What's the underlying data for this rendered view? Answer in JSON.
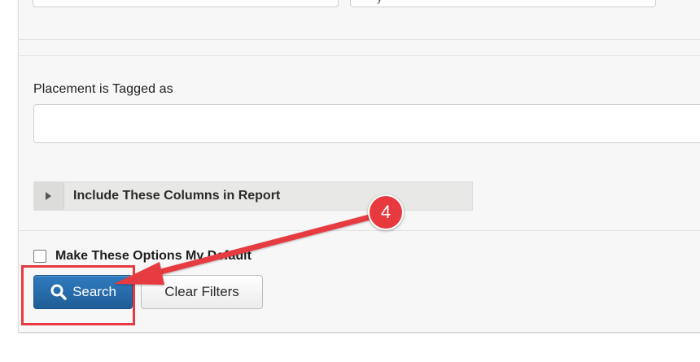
{
  "filters": {
    "placement_tag": {
      "label": "Placement is Tagged as",
      "value": "",
      "placeholder": ""
    },
    "top_right_glyph": "y"
  },
  "columns_section": {
    "label": "Include These Columns in Report",
    "expanded": false
  },
  "default_option": {
    "label": "Make These Options My Default",
    "checked": false
  },
  "actions": {
    "search_label": "Search",
    "clear_label": "Clear Filters"
  },
  "annotation": {
    "step_number": "4",
    "color": "#e63a3f"
  },
  "colors": {
    "primary_button": "#2a6fad",
    "panel_background": "#f7f7f7",
    "accordion_background": "#e8e8e6"
  },
  "icons": {
    "search": "magnifier-icon",
    "accordion_toggle": "caret-right-icon"
  }
}
